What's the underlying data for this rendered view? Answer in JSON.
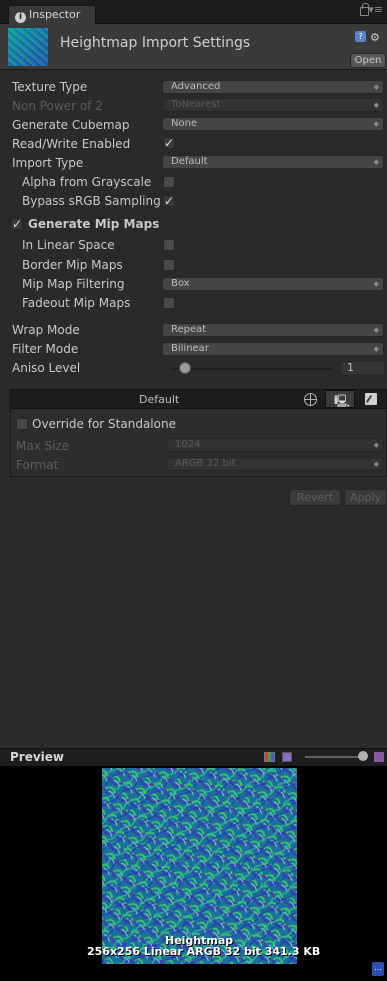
{
  "tab": {
    "title": "Inspector"
  },
  "header": {
    "title": "Heightmap Import Settings",
    "open_label": "Open"
  },
  "fields": {
    "texture_type": {
      "label": "Texture Type",
      "value": "Advanced"
    },
    "non_power_of_2": {
      "label": "Non Power of 2",
      "value": "ToNearest"
    },
    "generate_cubemap": {
      "label": "Generate Cubemap",
      "value": "None"
    },
    "read_write": {
      "label": "Read/Write Enabled",
      "checked": true
    },
    "import_type": {
      "label": "Import Type",
      "value": "Default"
    },
    "alpha_from_grayscale": {
      "label": "Alpha from Grayscale",
      "checked": false
    },
    "bypass_srgb": {
      "label": "Bypass sRGB Sampling",
      "checked": true
    },
    "generate_mip_maps": {
      "label": "Generate Mip Maps",
      "checked": true
    },
    "in_linear_space": {
      "label": "In Linear Space",
      "checked": false
    },
    "border_mip_maps": {
      "label": "Border Mip Maps",
      "checked": false
    },
    "mip_map_filtering": {
      "label": "Mip Map Filtering",
      "value": "Box"
    },
    "fadeout_mip_maps": {
      "label": "Fadeout Mip Maps",
      "checked": false
    },
    "wrap_mode": {
      "label": "Wrap Mode",
      "value": "Repeat"
    },
    "filter_mode": {
      "label": "Filter Mode",
      "value": "Bilinear"
    },
    "aniso_level": {
      "label": "Aniso Level",
      "value": "1"
    }
  },
  "platform": {
    "default_label": "Default",
    "override_label": "Override for Standalone",
    "max_size": {
      "label": "Max Size",
      "value": "1024"
    },
    "format": {
      "label": "Format",
      "value": "ARGB 32 bit"
    }
  },
  "buttons": {
    "revert": "Revert",
    "apply": "Apply"
  },
  "preview": {
    "label": "Preview",
    "caption_name": "Heightmap",
    "caption_info": "256x256 Linear  ARGB 32 bit   341.3 KB"
  },
  "icons": {
    "checkmark": "✓"
  },
  "colors": {
    "background": "#2a2a2a",
    "header": "#3a3a3a",
    "accent_blue": "#5b84c7"
  }
}
